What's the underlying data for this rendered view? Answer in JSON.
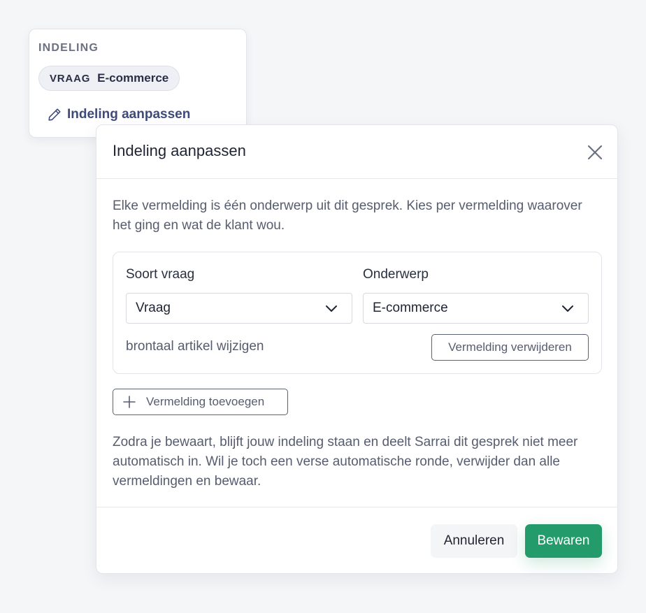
{
  "indeling": {
    "title": "INDELING",
    "tag": {
      "kind": "VRAAG",
      "topic": "E-commerce"
    },
    "edit_link": {
      "icon": "pencil-icon",
      "label": "Indeling aanpassen"
    }
  },
  "modal": {
    "title": "Indeling aanpassen",
    "close_icon": "close-icon",
    "intro": "Elke vermelding is één onderwerp uit dit gesprek. Kies per vermelding waarover het ging en wat de klant wou.",
    "entry": {
      "kind_label": "Soort vraag",
      "kind_value": "Vraag",
      "topic_label": "Onderwerp",
      "topic_value": "E-commerce",
      "note": "brontaal artikel wijzigen",
      "remove_label": "Vermelding verwijderen"
    },
    "add_label": "Vermelding toevoegen",
    "footer_note": "Zodra je bewaart, blijft jouw indeling staan en deelt Sarrai dit gesprek niet meer automatisch in. Wil je toch een verse automatische ronde, verwijder dan alle vermeldingen en bewaar.",
    "cancel_label": "Annuleren",
    "save_label": "Bewaren"
  },
  "colors": {
    "primary": "#239b6a",
    "link": "#3f4a7a",
    "muted_text": "#575d6e",
    "background": "#f5f6f8"
  }
}
